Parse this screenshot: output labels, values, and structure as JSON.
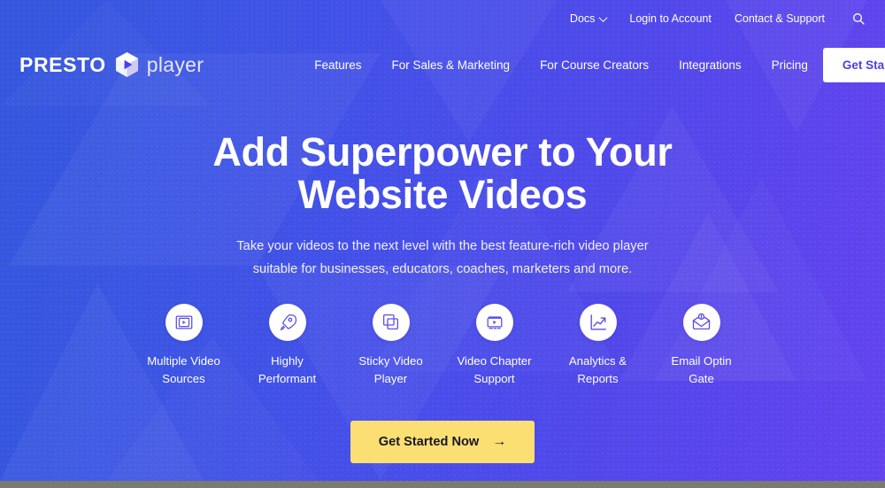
{
  "brand": {
    "name_bold": "PRESTO",
    "name_light": "player",
    "logo_icon": "presto-hexagon-play-icon"
  },
  "topbar": {
    "items": [
      {
        "label": "Docs",
        "icon": "chevron-down-icon",
        "has_caret": true
      },
      {
        "label": "Login to Account",
        "has_caret": false
      },
      {
        "label": "Contact & Support",
        "has_caret": false
      }
    ],
    "search_icon": "search-icon"
  },
  "nav": {
    "links": [
      {
        "label": "Features"
      },
      {
        "label": "For Sales & Marketing"
      },
      {
        "label": "For Course Creators"
      },
      {
        "label": "Integrations"
      },
      {
        "label": "Pricing"
      }
    ],
    "cta_label": "Get Started"
  },
  "hero": {
    "heading_line1": "Add Superpower to Your",
    "heading_line2": "Website Videos",
    "sub_line1": "Take your videos to the next level with the best feature-rich video player",
    "sub_line2": "suitable for businesses, educators, coaches, marketers and more.",
    "cta_label": "Get Started Now",
    "cta_arrow": "→"
  },
  "features": [
    {
      "icon": "multiple-video-sources-icon",
      "line1": "Multiple Video",
      "line2": "Sources"
    },
    {
      "icon": "rocket-icon",
      "line1": "Highly",
      "line2": "Performant"
    },
    {
      "icon": "sticky-video-player-icon",
      "line1": "Sticky Video",
      "line2": "Player"
    },
    {
      "icon": "video-chapter-icon",
      "line1": "Video Chapter",
      "line2": "Support"
    },
    {
      "icon": "analytics-chart-icon",
      "line1": "Analytics &",
      "line2": "Reports"
    },
    {
      "icon": "email-optin-envelope-icon",
      "line1": "Email Optin",
      "line2": "Gate"
    }
  ],
  "colors": {
    "gradient_left": "#3457dd",
    "gradient_right": "#6344ef",
    "cta_yellow": "#fbdf72",
    "cta_text": "#171728",
    "accent_purple": "#4a3fe8",
    "bottom_bar": "#7b7b73"
  }
}
